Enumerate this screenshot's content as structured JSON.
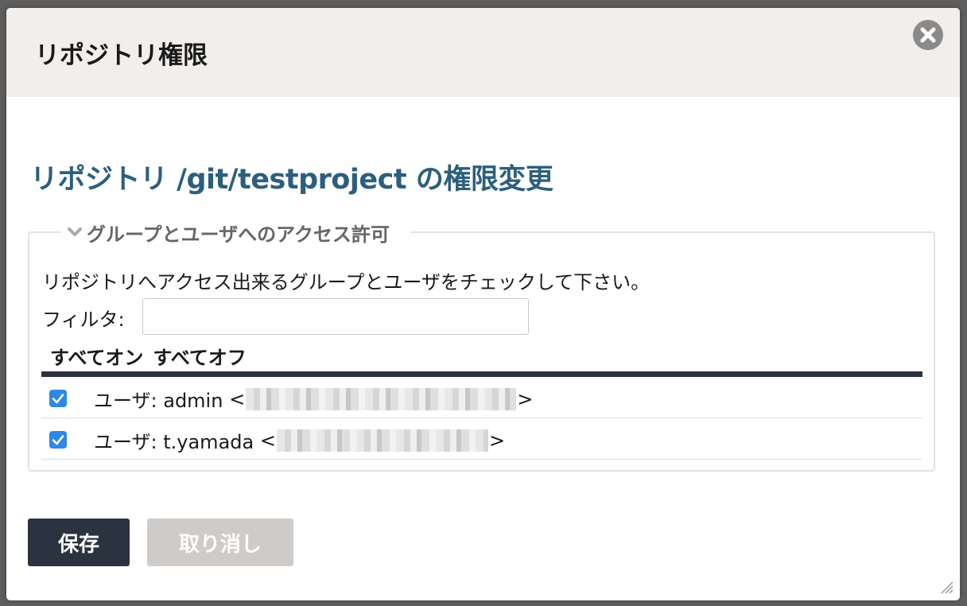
{
  "dialog": {
    "title": "リポジトリ権限",
    "close_icon": "close-icon"
  },
  "content": {
    "heading": "リポジトリ /git/testproject の権限変更"
  },
  "access_section": {
    "legend": "グループとユーザへのアクセス許可",
    "instruction": "リポジトリへアクセス出来るグループとユーザをチェックして下さい。",
    "filter_label": "フィルタ:",
    "filter_value": "",
    "filter_placeholder": "",
    "all_on": "すべてオン",
    "all_off": "すべてオフ",
    "members": [
      {
        "label": "ユーザ: admin",
        "checked": true
      },
      {
        "label": "ユーザ: t.yamada",
        "checked": true
      }
    ]
  },
  "buttons": {
    "save": "保存",
    "cancel": "取り消し"
  },
  "colors": {
    "header_bg": "#f1eeeb",
    "heading_text": "#2c5f7d",
    "primary_button": "#2b3240",
    "disabled_button": "#cfcbc8",
    "checkbox": "#2f87e6"
  }
}
